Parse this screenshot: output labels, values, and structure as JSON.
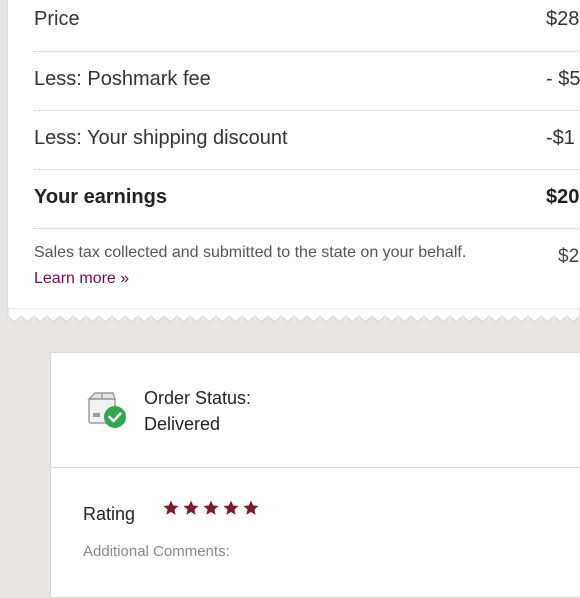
{
  "breakdown": {
    "price_label": "Price",
    "price_value": "$28",
    "fee_label": "Less: Poshmark fee",
    "fee_value": "- $5",
    "shipping_label": "Less: Your shipping discount",
    "shipping_value": "-$1",
    "earnings_label": "Your earnings",
    "earnings_value": "$20",
    "tax_text": "Sales tax collected and submitted to the state on your behalf.",
    "tax_value": "$2",
    "learn_more": "Learn more »"
  },
  "order_status": {
    "label": "Order Status:",
    "value": "Delivered",
    "icon": "delivered-box-icon"
  },
  "rating": {
    "label": "Rating",
    "stars": 5,
    "max_stars": 5,
    "star_color": "#7a1b2b",
    "comments_label": "Additional Comments:"
  },
  "colors": {
    "link": "#7f0353",
    "check_green": "#2fa84f",
    "background": "#e8e5e3"
  }
}
